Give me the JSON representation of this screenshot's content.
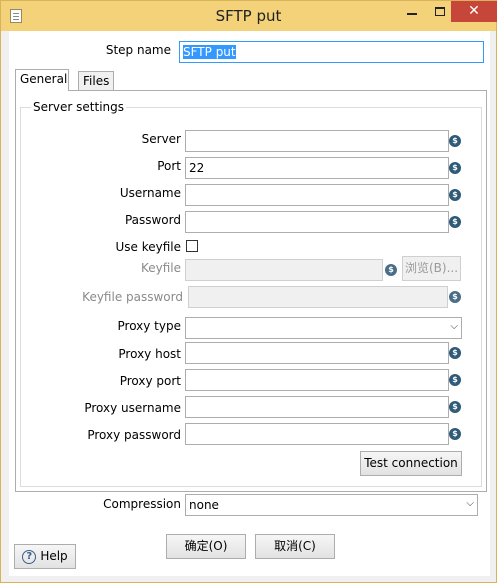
{
  "window": {
    "title": "SFTP put",
    "minimize_glyph": "minimize-icon",
    "maximize_glyph": "maximize-icon",
    "close_glyph": "✕"
  },
  "step": {
    "label": "Step name",
    "value": "SFTP put"
  },
  "tabs": [
    {
      "label": "General"
    },
    {
      "label": "Files"
    }
  ],
  "server": {
    "group_title": "Server settings",
    "fields": {
      "server": {
        "label": "Server",
        "value": ""
      },
      "port": {
        "label": "Port",
        "value": "22"
      },
      "username": {
        "label": "Username",
        "value": ""
      },
      "password": {
        "label": "Password",
        "value": ""
      },
      "use_keyfile": {
        "label": "Use keyfile",
        "checked": false
      },
      "keyfile": {
        "label": "Keyfile",
        "value": "",
        "browse_label": "浏览(B)..."
      },
      "keyfile_password": {
        "label": "Keyfile password",
        "value": ""
      },
      "proxy_type": {
        "label": "Proxy type",
        "value": ""
      },
      "proxy_host": {
        "label": "Proxy host",
        "value": ""
      },
      "proxy_port": {
        "label": "Proxy port",
        "value": ""
      },
      "proxy_username": {
        "label": "Proxy username",
        "value": ""
      },
      "proxy_password": {
        "label": "Proxy password",
        "value": ""
      }
    },
    "test_button": "Test connection"
  },
  "compression": {
    "label": "Compression",
    "value": "none"
  },
  "buttons": {
    "ok": "确定(O)",
    "cancel": "取消(C)",
    "help": "Help"
  },
  "icons": {
    "variable": "variable-dollar-icon",
    "help": "help-question-icon",
    "dropdown": "chevron-down-icon"
  },
  "colors": {
    "titlebar": "#f4d27a",
    "selection": "#3399ff",
    "variable_icon": "#2f5a78"
  }
}
